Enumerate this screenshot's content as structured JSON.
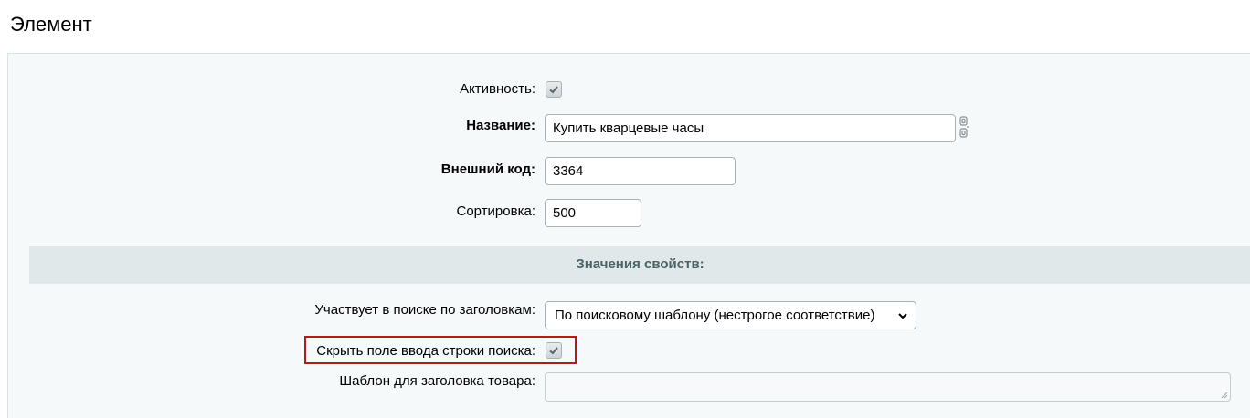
{
  "page": {
    "title": "Элемент"
  },
  "form": {
    "active": {
      "label": "Активность:",
      "checked": true
    },
    "name": {
      "label": "Название:",
      "value": "Купить кварцевые часы"
    },
    "external_code": {
      "label": "Внешний код:",
      "value": "3364"
    },
    "sort": {
      "label": "Сортировка:",
      "value": "500"
    }
  },
  "properties": {
    "section_title": "Значения свойств:",
    "search_by_titles": {
      "label": "Участвует в поиске по заголовкам:",
      "selected": "По поисковому шаблону (нестрогое соответствие)"
    },
    "hide_search_input": {
      "label": "Скрыть поле ввода строки поиска:",
      "checked": true
    },
    "title_template": {
      "label": "Шаблон для заголовка товара:",
      "value": ""
    }
  },
  "icons": {
    "checkmark": "check-icon",
    "translit": "translit-icon",
    "dropdown": "chevron-down-icon"
  },
  "colors": {
    "highlight_border": "#b01c1c",
    "section_band": "#e0e8ea",
    "section_text": "#4b6267",
    "panel_bg": "#f5f9f9"
  }
}
